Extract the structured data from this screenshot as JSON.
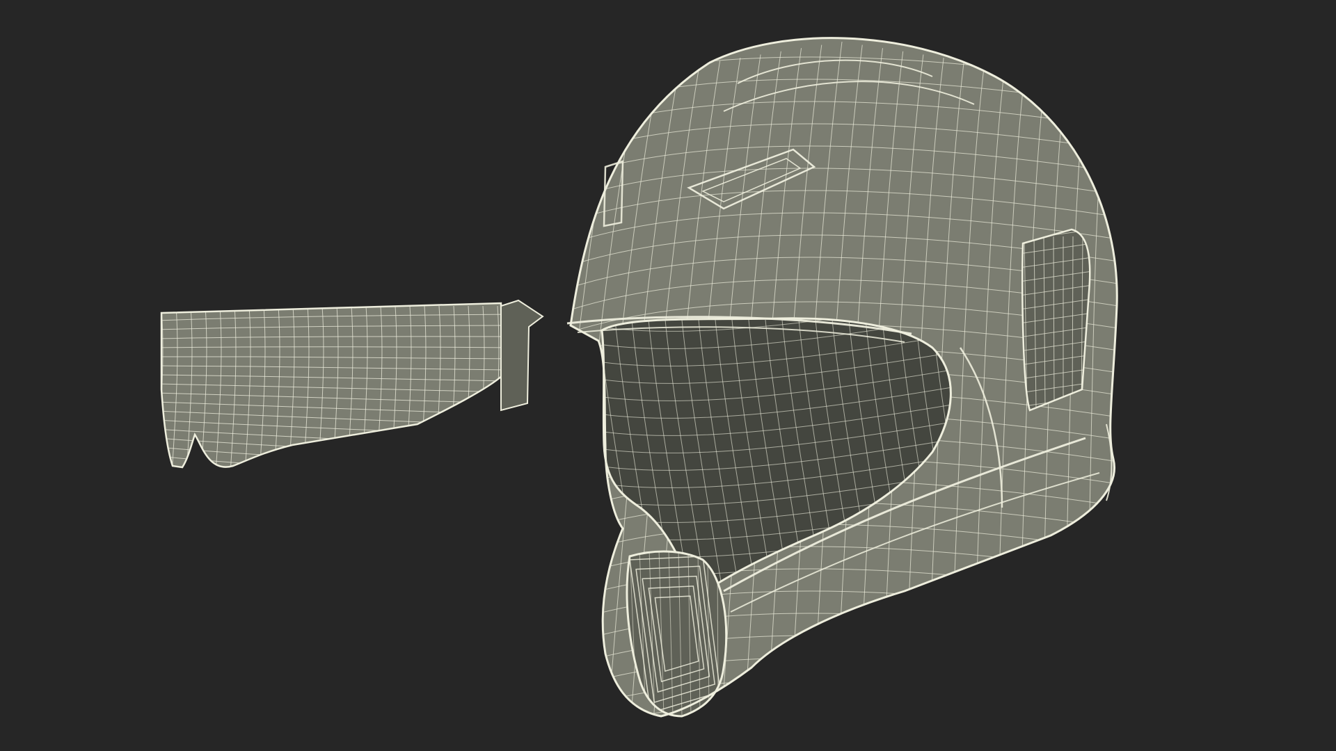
{
  "scene": {
    "background_color": "#262626",
    "surface_color": "#7b7d71",
    "surface_dark_color": "#5f6157",
    "interior_color": "#44463f",
    "wire_color": "#eeeedd"
  },
  "objects": [
    {
      "name": "visor",
      "icon": "visor-wireframe"
    },
    {
      "name": "helmet",
      "icon": "helmet-wireframe"
    }
  ]
}
